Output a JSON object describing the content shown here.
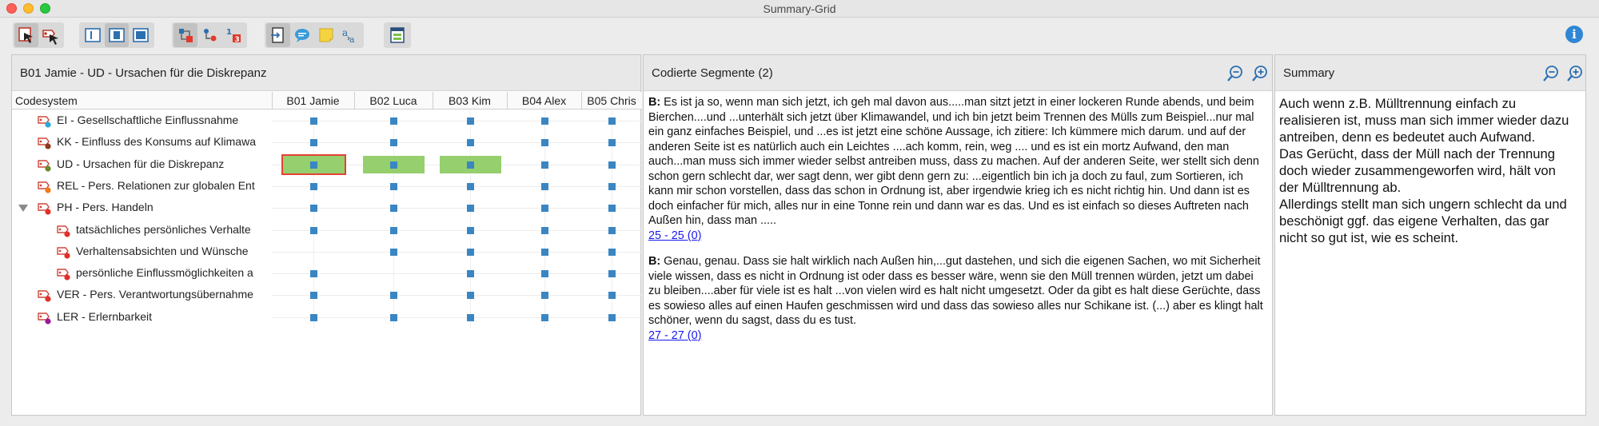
{
  "window": {
    "title": "Summary-Grid"
  },
  "colors": {
    "accent": "#2f86d4",
    "bar": "#96cf6e",
    "selection": "#e34234",
    "marker": "#3a86c3"
  },
  "toolbar": {
    "groups": [
      [
        "filter-documents-icon",
        "filter-codes-icon"
      ],
      [
        "view-left-icon",
        "view-middle-icon",
        "view-right-icon"
      ],
      [
        "grid-view-icon",
        "hierarchy-icon",
        "numbers-icon"
      ],
      [
        "export-icon",
        "comment-icon",
        "memo-icon",
        "font-size-icon"
      ],
      [
        "table-icon"
      ]
    ],
    "info": "i"
  },
  "grid_panel": {
    "title": "B01 Jamie - UD - Ursachen für die Diskrepanz",
    "codesystem_header": "Codesystem",
    "columns": [
      "B01 Jamie",
      "B02 Luca",
      "B03 Kim",
      "B04 Alex",
      "B05 Chris"
    ],
    "rows": [
      {
        "label": "EI - Gesellschaftliche Einflussnahme",
        "indent": 0,
        "color": "#2aa8d8"
      },
      {
        "label": "KK - Einfluss des Konsums auf Klimawa",
        "indent": 0,
        "color": "#8b3a1a"
      },
      {
        "label": "UD - Ursachen für die Diskrepanz",
        "indent": 0,
        "color": "#6a8a2a"
      },
      {
        "label": "REL - Pers. Relationen zur globalen Ent",
        "indent": 0,
        "color": "#f07a1a"
      },
      {
        "label": "PH - Pers. Handeln",
        "indent": 0,
        "color": "#e0302a",
        "expanded": true
      },
      {
        "label": "tatsächliches persönliches Verhalte",
        "indent": 1,
        "color": "#e0302a"
      },
      {
        "label": "Verhaltensabsichten und Wünsche",
        "indent": 1,
        "color": "#e0302a"
      },
      {
        "label": "persönliche Einflussmöglichkeiten a",
        "indent": 1,
        "color": "#e0302a"
      },
      {
        "label": "VER - Pers. Verantwortungsübernahme",
        "indent": 0,
        "color": "#e0302a"
      },
      {
        "label": "LER - Erlernbarkeit",
        "indent": 0,
        "color": "#9a1a9a"
      }
    ],
    "cells": [
      [
        1,
        1,
        1,
        1,
        1
      ],
      [
        1,
        1,
        1,
        1,
        1
      ],
      [
        2,
        2,
        2,
        1,
        1
      ],
      [
        1,
        1,
        1,
        1,
        1
      ],
      [
        1,
        1,
        1,
        1,
        1
      ],
      [
        1,
        1,
        1,
        1,
        1
      ],
      [
        0,
        1,
        1,
        1,
        1
      ],
      [
        1,
        0,
        1,
        1,
        1
      ],
      [
        1,
        1,
        1,
        1,
        1
      ],
      [
        1,
        1,
        1,
        1,
        1
      ]
    ],
    "selected": [
      2,
      0
    ]
  },
  "segments_panel": {
    "title": "Codierte Segmente (2)",
    "segments": [
      {
        "speaker": "B:",
        "text": " Es ist ja so, wenn man sich jetzt, ich geh mal davon aus.....man sitzt jetzt in einer lockeren Runde abends, und beim Bierchen....und ...unterhält sich jetzt über Klimawandel, und ich bin jetzt beim Trennen des Mülls zum Beispiel...nur mal ein ganz einfaches Beispiel, und ...es ist jetzt eine schöne Aussage, ich zitiere: Ich kümmere mich darum. und auf der anderen Seite ist es natürlich auch ein Leichtes ....ach komm, rein, weg .... und es ist ein mortz Aufwand, den man auch...man muss sich immer wieder selbst antreiben muss, dass zu machen. Auf der anderen Seite, wer stellt sich denn schon gern schlecht dar, wer sagt denn, wer gibt denn gern zu: ...eigentlich bin ich ja doch zu faul, zum Sortieren, ich kann mir schon vorstellen, dass das schon in Ordnung ist, aber irgendwie krieg ich es nicht richtig hin. Und dann ist es doch einfacher für mich, alles nur in eine Tonne rein und dann war es das. Und es ist einfach so dieses Auftreten nach Außen hin, dass man .....",
        "link": "25 - 25  (0)"
      },
      {
        "speaker": "B:",
        "text": " Genau, genau. Dass sie halt wirklich nach Außen hin,...gut dastehen, und sich die eigenen Sachen, wo mit Sicherheit viele wissen, dass es nicht in Ordnung ist oder dass es besser wäre, wenn sie den Müll trennen würden, jetzt um dabei zu bleiben....aber für viele ist es halt ...von vielen wird es halt nicht umgesetzt. Oder da gibt es halt diese Gerüchte, dass es sowieso alles auf einen Haufen geschmissen wird und dass das sowieso alles nur Schikane ist. (...) aber es klingt halt schöner, wenn du sagst, dass du es tust.",
        "link": "27 - 27  (0)"
      }
    ]
  },
  "summary_panel": {
    "title": "Summary",
    "text": "Auch wenn z.B. Mülltrennung einfach zu realisieren ist, muss man sich immer wieder dazu antreiben, denn es bedeutet auch Aufwand.\nDas Gerücht, dass der Müll nach der Trennung doch wieder zusammengeworfen wird, hält von der Mülltrennung ab.\nAllerdings stellt man sich ungern schlecht da und beschönigt ggf. das eigene Verhalten, das gar nicht so gut ist, wie es scheint."
  }
}
